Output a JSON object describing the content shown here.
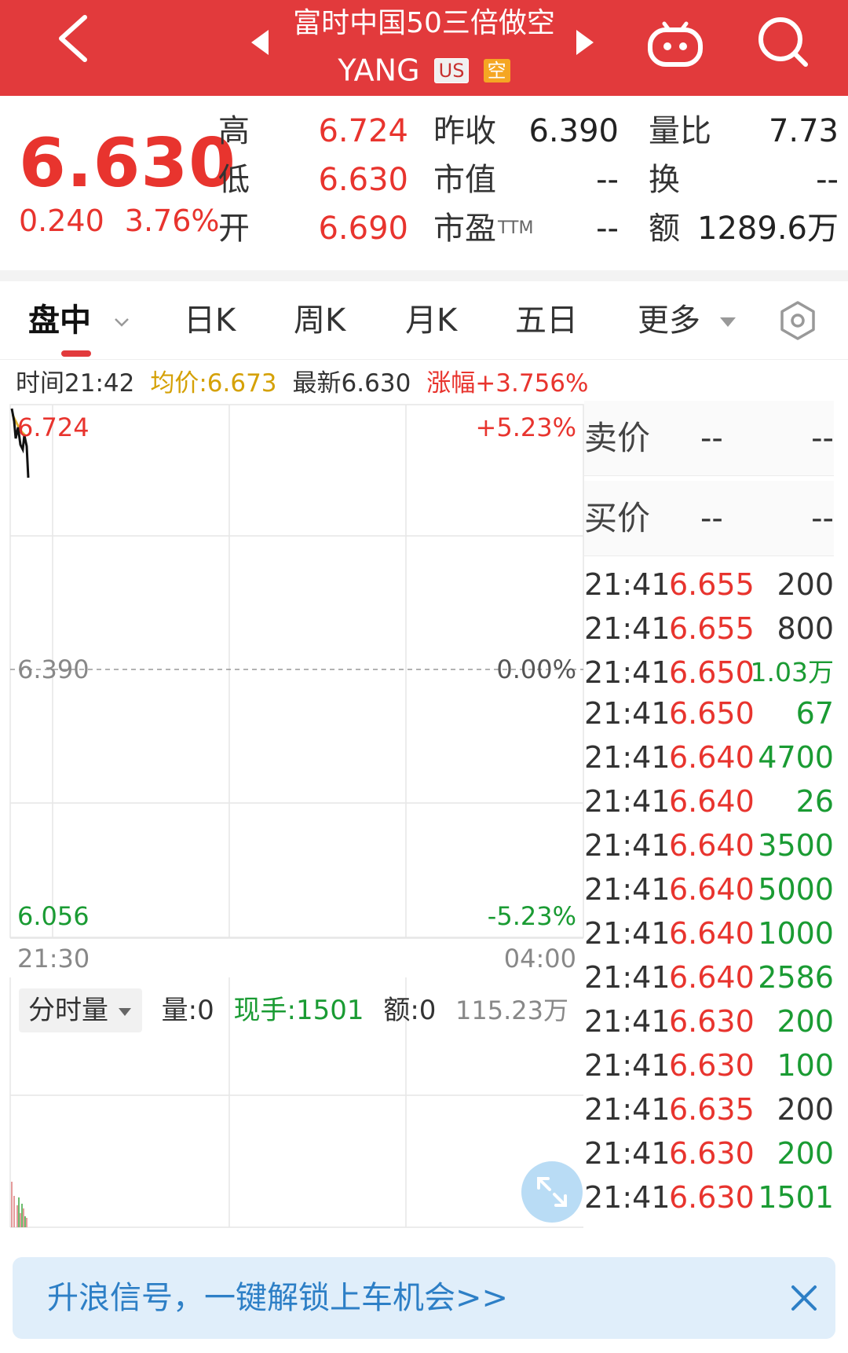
{
  "colors": {
    "header_red": "#e23a3c",
    "price_up": "#e8342e",
    "price_down": "#1a9b33",
    "avg_yellow": "#d5a106",
    "banner_blue": "#2d7fc6"
  },
  "header": {
    "title": "富时中国50三倍做空",
    "symbol": "YANG",
    "market_tag": "US",
    "short_tag": "空",
    "icons": [
      "back-icon",
      "prev-arrow-icon",
      "next-arrow-icon",
      "robot-icon",
      "search-icon"
    ]
  },
  "quote": {
    "price": "6.630",
    "change": "0.240",
    "change_pct": "3.76%",
    "high_label": "高",
    "high": "6.724",
    "low_label": "低",
    "low": "6.630",
    "open_label": "开",
    "open": "6.690",
    "prev_close_label": "昨收",
    "prev_close": "6.390",
    "market_cap_label": "市值",
    "market_cap": "--",
    "pe_label": "市盈",
    "pe_sup": "TTM",
    "pe": "--",
    "vol_ratio_label": "量比",
    "vol_ratio": "7.73",
    "turnover_label": "换",
    "turnover": "--",
    "amount_label": "额",
    "amount": "1289.6万"
  },
  "tabs": [
    {
      "label": "盘中",
      "active": true
    },
    {
      "label": "日K"
    },
    {
      "label": "周K"
    },
    {
      "label": "月K"
    },
    {
      "label": "五日"
    },
    {
      "label": "更多"
    }
  ],
  "info": {
    "time": "时间21:42",
    "avg": "均价:6.673",
    "latest": "最新6.630",
    "change": "涨幅+3.756%"
  },
  "chart": {
    "y_top": "6.724",
    "y_mid": "6.390",
    "y_bottom": "6.056",
    "pct_top": "+5.23%",
    "pct_mid": "0.00%",
    "pct_bottom": "-5.23%",
    "x_start": "21:30",
    "x_end": "04:00"
  },
  "volume": {
    "selector": "分时量",
    "vol": "量:0",
    "current_hand": "现手:1501",
    "amount": "额:0",
    "max": "115.23万"
  },
  "book": {
    "sell_label": "卖价",
    "sell_price": "--",
    "sell_qty": "--",
    "buy_label": "买价",
    "buy_price": "--",
    "buy_qty": "--",
    "ticks": [
      {
        "time": "21:41",
        "price": "6.655",
        "qty": "200",
        "dir": "neutral"
      },
      {
        "time": "21:41",
        "price": "6.655",
        "qty": "800",
        "dir": "neutral"
      },
      {
        "time": "21:41",
        "price": "6.650",
        "qty": "1.03万",
        "dir": "down"
      },
      {
        "time": "21:41",
        "price": "6.650",
        "qty": "67",
        "dir": "down"
      },
      {
        "time": "21:41",
        "price": "6.640",
        "qty": "4700",
        "dir": "down"
      },
      {
        "time": "21:41",
        "price": "6.640",
        "qty": "26",
        "dir": "down"
      },
      {
        "time": "21:41",
        "price": "6.640",
        "qty": "3500",
        "dir": "down"
      },
      {
        "time": "21:41",
        "price": "6.640",
        "qty": "5000",
        "dir": "down"
      },
      {
        "time": "21:41",
        "price": "6.640",
        "qty": "1000",
        "dir": "down"
      },
      {
        "time": "21:41",
        "price": "6.640",
        "qty": "2586",
        "dir": "down"
      },
      {
        "time": "21:41",
        "price": "6.630",
        "qty": "200",
        "dir": "down"
      },
      {
        "time": "21:41",
        "price": "6.630",
        "qty": "100",
        "dir": "down"
      },
      {
        "time": "21:41",
        "price": "6.635",
        "qty": "200",
        "dir": "neutral"
      },
      {
        "time": "21:41",
        "price": "6.630",
        "qty": "200",
        "dir": "down"
      },
      {
        "time": "21:41",
        "price": "6.630",
        "qty": "1501",
        "dir": "down"
      }
    ]
  },
  "banner": {
    "text": "升浪信号，一键解锁上车机会>>"
  }
}
